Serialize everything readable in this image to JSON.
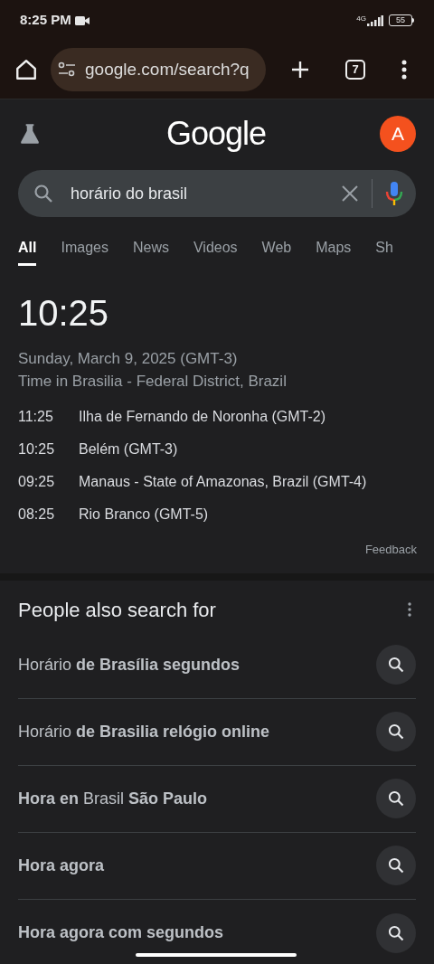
{
  "status_bar": {
    "time": "8:25 PM",
    "network": "4G",
    "battery": "55"
  },
  "browser_toolbar": {
    "url": "google.com/search?q",
    "tab_count": "7"
  },
  "header": {
    "logo": "Google",
    "avatar": "A"
  },
  "search": {
    "value": "horário do brasil"
  },
  "tabs": [
    {
      "label": "All",
      "selected": true
    },
    {
      "label": "Images",
      "selected": false
    },
    {
      "label": "News",
      "selected": false
    },
    {
      "label": "Videos",
      "selected": false
    },
    {
      "label": "Web",
      "selected": false
    },
    {
      "label": "Maps",
      "selected": false
    },
    {
      "label": "Sh",
      "selected": false
    }
  ],
  "clock": {
    "time": "10:25",
    "date": "Sunday, March 9, 2025 (GMT-3)",
    "location": "Time in Brasilia - Federal District, Brazil",
    "zones": [
      {
        "time": "11:25",
        "place": "Ilha de Fernando de Noronha (GMT-2)"
      },
      {
        "time": "10:25",
        "place": "Belém (GMT-3)"
      },
      {
        "time": "09:25",
        "place": "Manaus - State of Amazonas, Brazil (GMT-4)"
      },
      {
        "time": "08:25",
        "place": "Rio Branco (GMT-5)"
      }
    ],
    "feedback": "Feedback"
  },
  "related": {
    "title": "People also search for",
    "items": [
      {
        "text": "Horário **de Brasília segundos**"
      },
      {
        "text": "Horário **de Brasilia relógio online**"
      },
      {
        "text": "**Hora en** Brasil **São Paulo**"
      },
      {
        "text": "**Hora agora**"
      },
      {
        "text": "**Hora agora com segundos**"
      }
    ]
  }
}
